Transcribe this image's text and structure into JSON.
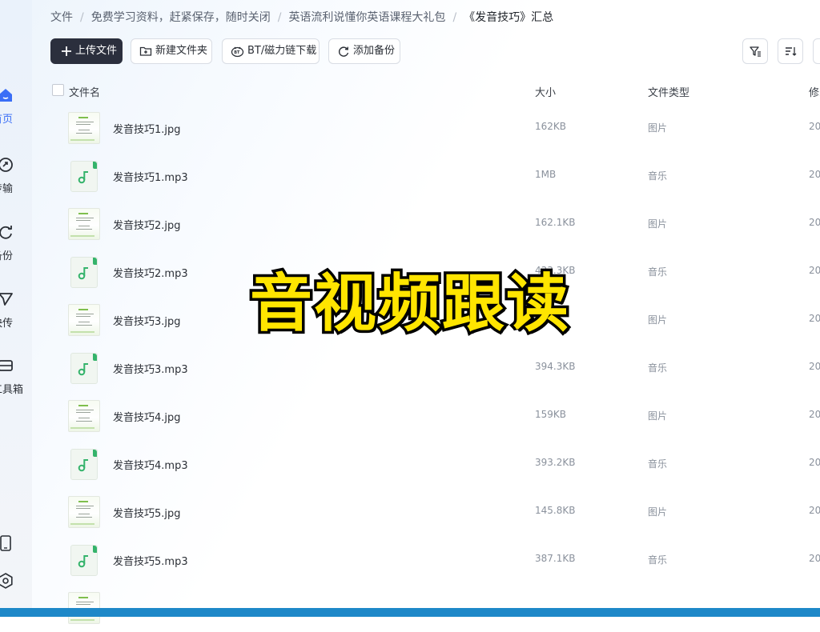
{
  "sidebar": {
    "items": [
      {
        "label": "首页",
        "icon": "home-icon",
        "active": true
      },
      {
        "label": "传输",
        "icon": "transfer-icon"
      },
      {
        "label": "备份",
        "icon": "backup-icon"
      },
      {
        "label": "快传",
        "icon": "quick-send-icon"
      },
      {
        "label": "工具箱",
        "icon": "toolbox-icon"
      }
    ],
    "bottom_icons": [
      "phone-icon",
      "settings-icon"
    ]
  },
  "breadcrumb": [
    "文件",
    "免费学习资料，赶紧保存，随时关闭",
    "英语流利说懂你英语课程大礼包",
    "《发音技巧》汇总"
  ],
  "toolbar": {
    "upload": "上传文件",
    "new_folder": "新建文件夹",
    "bt": "BT/磁力链下载",
    "backup": "添加备份"
  },
  "table": {
    "headers": {
      "name": "文件名",
      "size": "大小",
      "type": "文件类型",
      "modified": "修改"
    },
    "rows": [
      {
        "name": "发音技巧1.jpg",
        "size": "162KB",
        "type": "图片",
        "kind": "image",
        "date": "20"
      },
      {
        "name": "发音技巧1.mp3",
        "size": "1MB",
        "type": "音乐",
        "kind": "audio",
        "date": "20"
      },
      {
        "name": "发音技巧2.jpg",
        "size": "162.1KB",
        "type": "图片",
        "kind": "image",
        "date": "20"
      },
      {
        "name": "发音技巧2.mp3",
        "size": "433.3KB",
        "type": "音乐",
        "kind": "audio",
        "date": "20"
      },
      {
        "name": "发音技巧3.jpg",
        "size": "",
        "type": "图片",
        "kind": "image",
        "date": "20"
      },
      {
        "name": "发音技巧3.mp3",
        "size": "394.3KB",
        "type": "音乐",
        "kind": "audio",
        "date": "20"
      },
      {
        "name": "发音技巧4.jpg",
        "size": "159KB",
        "type": "图片",
        "kind": "image",
        "date": "20"
      },
      {
        "name": "发音技巧4.mp3",
        "size": "393.2KB",
        "type": "音乐",
        "kind": "audio",
        "date": "20"
      },
      {
        "name": "发音技巧5.jpg",
        "size": "145.8KB",
        "type": "图片",
        "kind": "image",
        "date": "20"
      },
      {
        "name": "发音技巧5.mp3",
        "size": "387.1KB",
        "type": "音乐",
        "kind": "audio",
        "date": "20"
      },
      {
        "name": "",
        "size": "",
        "type": "",
        "kind": "image",
        "date": ""
      }
    ]
  },
  "overlay_text": "音视频跟读",
  "colors": {
    "accent": "#3a6ef6",
    "primary_button": "#2b2f3d",
    "audio_icon": "#34b36b",
    "overlay": "#ffe500"
  }
}
